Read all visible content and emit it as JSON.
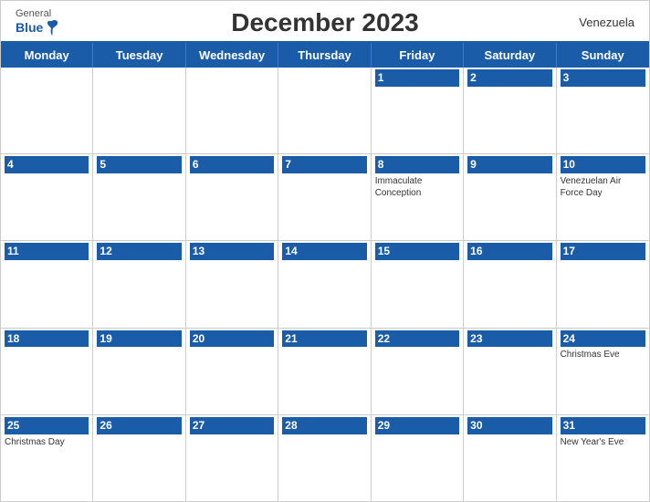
{
  "header": {
    "title": "December 2023",
    "country": "Venezuela",
    "logo": {
      "general": "General",
      "blue": "Blue"
    }
  },
  "dayHeaders": [
    "Monday",
    "Tuesday",
    "Wednesday",
    "Thursday",
    "Friday",
    "Saturday",
    "Sunday"
  ],
  "weeks": [
    [
      {
        "day": "",
        "event": ""
      },
      {
        "day": "",
        "event": ""
      },
      {
        "day": "",
        "event": ""
      },
      {
        "day": "",
        "event": ""
      },
      {
        "day": "1",
        "event": ""
      },
      {
        "day": "2",
        "event": ""
      },
      {
        "day": "3",
        "event": ""
      }
    ],
    [
      {
        "day": "4",
        "event": ""
      },
      {
        "day": "5",
        "event": ""
      },
      {
        "day": "6",
        "event": ""
      },
      {
        "day": "7",
        "event": ""
      },
      {
        "day": "8",
        "event": "Immaculate Conception"
      },
      {
        "day": "9",
        "event": ""
      },
      {
        "day": "10",
        "event": "Venezuelan Air Force Day"
      }
    ],
    [
      {
        "day": "11",
        "event": ""
      },
      {
        "day": "12",
        "event": ""
      },
      {
        "day": "13",
        "event": ""
      },
      {
        "day": "14",
        "event": ""
      },
      {
        "day": "15",
        "event": ""
      },
      {
        "day": "16",
        "event": ""
      },
      {
        "day": "17",
        "event": ""
      }
    ],
    [
      {
        "day": "18",
        "event": ""
      },
      {
        "day": "19",
        "event": ""
      },
      {
        "day": "20",
        "event": ""
      },
      {
        "day": "21",
        "event": ""
      },
      {
        "day": "22",
        "event": ""
      },
      {
        "day": "23",
        "event": ""
      },
      {
        "day": "24",
        "event": "Christmas Eve"
      }
    ],
    [
      {
        "day": "25",
        "event": "Christmas Day"
      },
      {
        "day": "26",
        "event": ""
      },
      {
        "day": "27",
        "event": ""
      },
      {
        "day": "28",
        "event": ""
      },
      {
        "day": "29",
        "event": ""
      },
      {
        "day": "30",
        "event": ""
      },
      {
        "day": "31",
        "event": "New Year's Eve"
      }
    ]
  ]
}
